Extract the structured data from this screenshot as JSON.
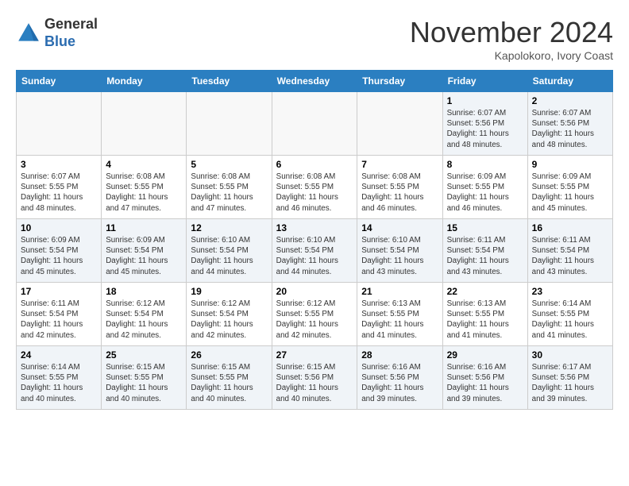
{
  "header": {
    "logo_line1": "General",
    "logo_line2": "Blue",
    "month": "November 2024",
    "location": "Kapolokoro, Ivory Coast"
  },
  "weekdays": [
    "Sunday",
    "Monday",
    "Tuesday",
    "Wednesday",
    "Thursday",
    "Friday",
    "Saturday"
  ],
  "weeks": [
    [
      {
        "day": "",
        "info": ""
      },
      {
        "day": "",
        "info": ""
      },
      {
        "day": "",
        "info": ""
      },
      {
        "day": "",
        "info": ""
      },
      {
        "day": "",
        "info": ""
      },
      {
        "day": "1",
        "info": "Sunrise: 6:07 AM\nSunset: 5:56 PM\nDaylight: 11 hours\nand 48 minutes."
      },
      {
        "day": "2",
        "info": "Sunrise: 6:07 AM\nSunset: 5:56 PM\nDaylight: 11 hours\nand 48 minutes."
      }
    ],
    [
      {
        "day": "3",
        "info": "Sunrise: 6:07 AM\nSunset: 5:55 PM\nDaylight: 11 hours\nand 48 minutes."
      },
      {
        "day": "4",
        "info": "Sunrise: 6:08 AM\nSunset: 5:55 PM\nDaylight: 11 hours\nand 47 minutes."
      },
      {
        "day": "5",
        "info": "Sunrise: 6:08 AM\nSunset: 5:55 PM\nDaylight: 11 hours\nand 47 minutes."
      },
      {
        "day": "6",
        "info": "Sunrise: 6:08 AM\nSunset: 5:55 PM\nDaylight: 11 hours\nand 46 minutes."
      },
      {
        "day": "7",
        "info": "Sunrise: 6:08 AM\nSunset: 5:55 PM\nDaylight: 11 hours\nand 46 minutes."
      },
      {
        "day": "8",
        "info": "Sunrise: 6:09 AM\nSunset: 5:55 PM\nDaylight: 11 hours\nand 46 minutes."
      },
      {
        "day": "9",
        "info": "Sunrise: 6:09 AM\nSunset: 5:55 PM\nDaylight: 11 hours\nand 45 minutes."
      }
    ],
    [
      {
        "day": "10",
        "info": "Sunrise: 6:09 AM\nSunset: 5:54 PM\nDaylight: 11 hours\nand 45 minutes."
      },
      {
        "day": "11",
        "info": "Sunrise: 6:09 AM\nSunset: 5:54 PM\nDaylight: 11 hours\nand 45 minutes."
      },
      {
        "day": "12",
        "info": "Sunrise: 6:10 AM\nSunset: 5:54 PM\nDaylight: 11 hours\nand 44 minutes."
      },
      {
        "day": "13",
        "info": "Sunrise: 6:10 AM\nSunset: 5:54 PM\nDaylight: 11 hours\nand 44 minutes."
      },
      {
        "day": "14",
        "info": "Sunrise: 6:10 AM\nSunset: 5:54 PM\nDaylight: 11 hours\nand 43 minutes."
      },
      {
        "day": "15",
        "info": "Sunrise: 6:11 AM\nSunset: 5:54 PM\nDaylight: 11 hours\nand 43 minutes."
      },
      {
        "day": "16",
        "info": "Sunrise: 6:11 AM\nSunset: 5:54 PM\nDaylight: 11 hours\nand 43 minutes."
      }
    ],
    [
      {
        "day": "17",
        "info": "Sunrise: 6:11 AM\nSunset: 5:54 PM\nDaylight: 11 hours\nand 42 minutes."
      },
      {
        "day": "18",
        "info": "Sunrise: 6:12 AM\nSunset: 5:54 PM\nDaylight: 11 hours\nand 42 minutes."
      },
      {
        "day": "19",
        "info": "Sunrise: 6:12 AM\nSunset: 5:54 PM\nDaylight: 11 hours\nand 42 minutes."
      },
      {
        "day": "20",
        "info": "Sunrise: 6:12 AM\nSunset: 5:55 PM\nDaylight: 11 hours\nand 42 minutes."
      },
      {
        "day": "21",
        "info": "Sunrise: 6:13 AM\nSunset: 5:55 PM\nDaylight: 11 hours\nand 41 minutes."
      },
      {
        "day": "22",
        "info": "Sunrise: 6:13 AM\nSunset: 5:55 PM\nDaylight: 11 hours\nand 41 minutes."
      },
      {
        "day": "23",
        "info": "Sunrise: 6:14 AM\nSunset: 5:55 PM\nDaylight: 11 hours\nand 41 minutes."
      }
    ],
    [
      {
        "day": "24",
        "info": "Sunrise: 6:14 AM\nSunset: 5:55 PM\nDaylight: 11 hours\nand 40 minutes."
      },
      {
        "day": "25",
        "info": "Sunrise: 6:15 AM\nSunset: 5:55 PM\nDaylight: 11 hours\nand 40 minutes."
      },
      {
        "day": "26",
        "info": "Sunrise: 6:15 AM\nSunset: 5:55 PM\nDaylight: 11 hours\nand 40 minutes."
      },
      {
        "day": "27",
        "info": "Sunrise: 6:15 AM\nSunset: 5:56 PM\nDaylight: 11 hours\nand 40 minutes."
      },
      {
        "day": "28",
        "info": "Sunrise: 6:16 AM\nSunset: 5:56 PM\nDaylight: 11 hours\nand 39 minutes."
      },
      {
        "day": "29",
        "info": "Sunrise: 6:16 AM\nSunset: 5:56 PM\nDaylight: 11 hours\nand 39 minutes."
      },
      {
        "day": "30",
        "info": "Sunrise: 6:17 AM\nSunset: 5:56 PM\nDaylight: 11 hours\nand 39 minutes."
      }
    ]
  ]
}
